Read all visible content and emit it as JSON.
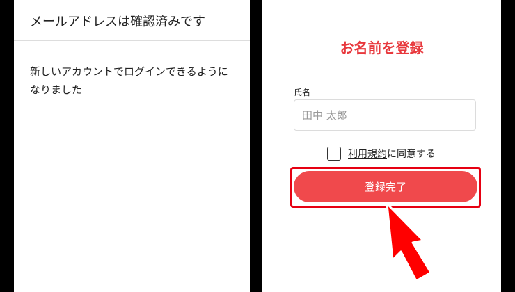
{
  "colors": {
    "background": "#000000",
    "accent": "#e8383d",
    "button": "#f0494c",
    "highlight": "#e60012",
    "arrow": "#ff0000"
  },
  "left_screen": {
    "title": "メールアドレスは確認済みです",
    "message": "新しいアカウントでログインできるようになりました"
  },
  "right_screen": {
    "title": "お名前を登録",
    "name_label": "氏名",
    "name_placeholder": "田中 太郎",
    "name_value": "",
    "terms_link": "利用規約",
    "terms_text": "に同意する",
    "terms_checked": false,
    "submit_label": "登録完了"
  },
  "annotation": {
    "arrow_icon": "red-pointer-arrow-icon"
  }
}
